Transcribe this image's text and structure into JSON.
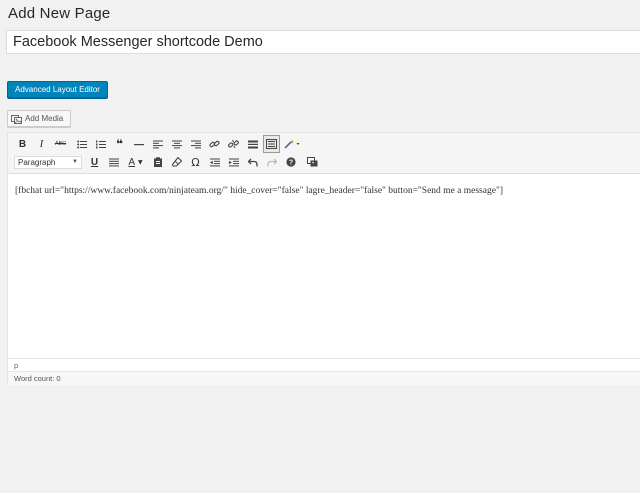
{
  "page": {
    "title": "Add New Page"
  },
  "post_title": {
    "value": "Facebook Messenger shortcode Demo"
  },
  "buttons": {
    "advanced_layout_editor": "Advanced Layout Editor",
    "add_media": "Add Media"
  },
  "toolbar": {
    "row1": [
      "bold-icon",
      "italic-icon",
      "strikethrough-icon",
      "bullet-list-icon",
      "numbered-list-icon",
      "blockquote-icon",
      "horizontal-line-icon",
      "align-left-icon",
      "align-center-icon",
      "align-right-icon",
      "link-icon",
      "unlink-icon",
      "read-more-icon",
      "toolbar-toggle-icon",
      "magic-wand-icon"
    ],
    "bold": "B",
    "italic": "I",
    "strikethrough": "ABC",
    "blockquote": "❝",
    "format_select": "Paragraph",
    "underline": "U",
    "text_color": "A",
    "omega": "Ω"
  },
  "editor": {
    "content": "[fbchat url=\"https://www.facebook.com/ninjateam.org/\" hide_cover=\"false\" lagre_header=\"false\" button=\"Send me a message\"]",
    "path": "p",
    "word_count": "Word count: 0"
  },
  "colors": {
    "background": "#f1f1f1",
    "primary_button": "#0085ba",
    "toolbar_bg": "#f5f5f5"
  }
}
